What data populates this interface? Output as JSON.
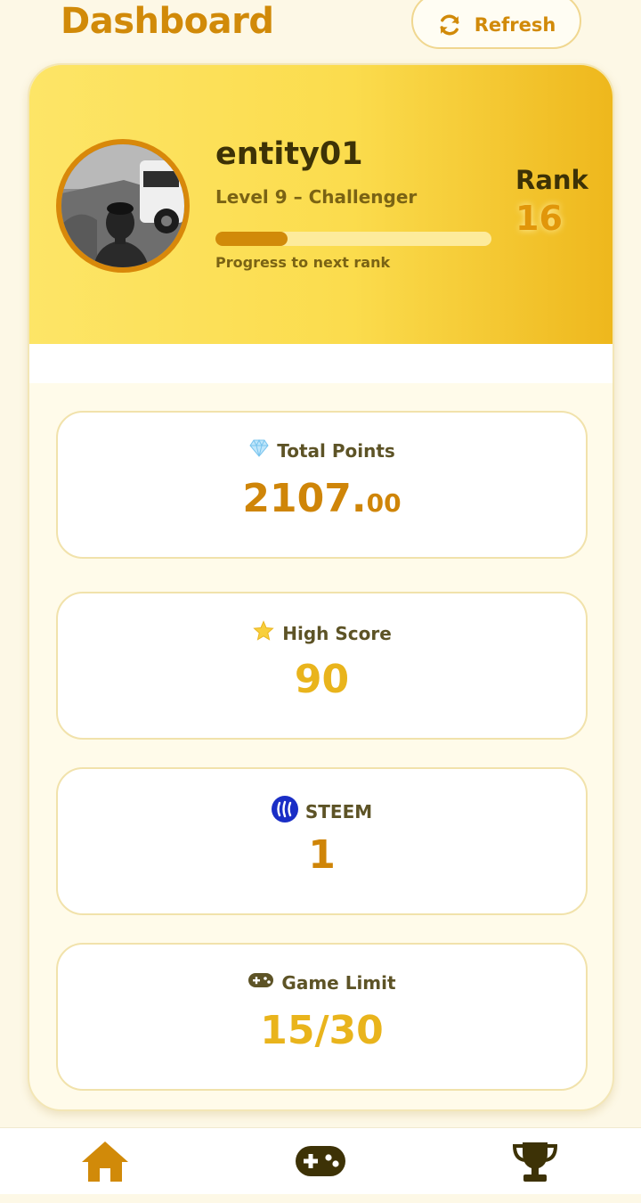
{
  "header": {
    "title": "Dashboard",
    "refresh_label": "Refresh"
  },
  "profile": {
    "username": "entity01",
    "level": "Level 9 – Challenger",
    "progress_fraction": 0.26,
    "progress_label": "Progress to next rank",
    "rank_label": "Rank",
    "rank_value": "16"
  },
  "stats": {
    "total_points": {
      "icon": "gem-icon",
      "label": "Total Points",
      "value_int": "2107.",
      "value_dec": "00"
    },
    "high_score": {
      "icon": "star-icon",
      "label": "High Score",
      "value": "90"
    },
    "steem": {
      "icon": "steem-logo-icon",
      "label": "STEEM",
      "value": "1"
    },
    "game_limit": {
      "icon": "gamepad-icon",
      "label": "Game Limit",
      "value": "15/30"
    }
  },
  "nav": {
    "items": [
      {
        "icon": "home-icon",
        "active": true
      },
      {
        "icon": "gamepad-icon",
        "active": false
      },
      {
        "icon": "trophy-icon",
        "active": false
      }
    ]
  },
  "colors": {
    "accent": "#d18a09",
    "gold": "#e9b41c",
    "dark": "#3d3206",
    "background": "#fdf8e6"
  }
}
